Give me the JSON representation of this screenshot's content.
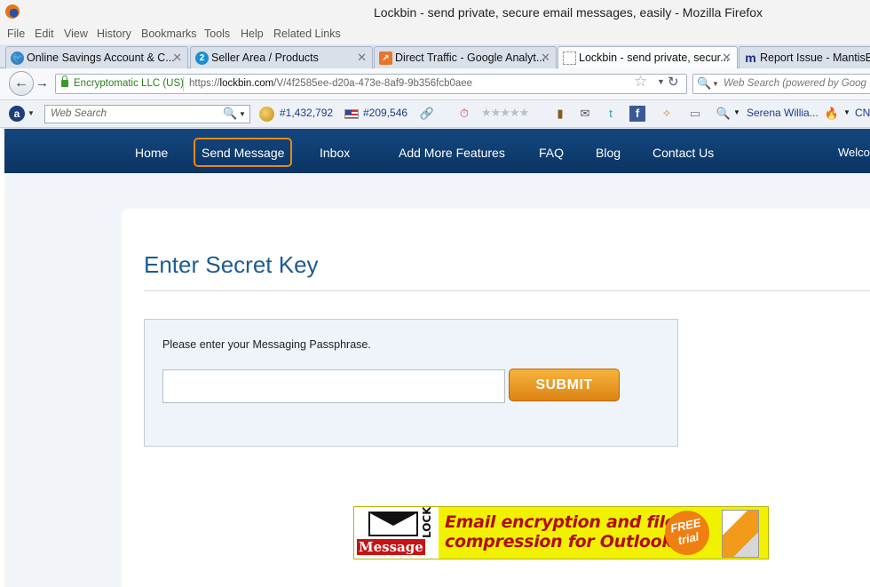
{
  "window": {
    "title": "Lockbin - send private, secure email messages, easily - Mozilla Firefox"
  },
  "menu": [
    "File",
    "Edit",
    "View",
    "History",
    "Bookmarks",
    "Tools",
    "Help",
    "Related Links"
  ],
  "tabs": [
    {
      "label": "Online Savings Account & C...",
      "icon": "blue-bird-icon"
    },
    {
      "label": "Seller Area / Products",
      "icon": "number-2-icon"
    },
    {
      "label": "Direct Traffic - Google Analyt...",
      "icon": "analytics-icon"
    },
    {
      "label": "Lockbin - send private, secur...",
      "icon": "blank-page-icon",
      "active": true
    },
    {
      "label": "Report Issue - MantisBT",
      "icon": "mantis-icon"
    }
  ],
  "navbar": {
    "identity": "Encryptomatic LLC (US)",
    "url_prefix": "https://",
    "url_host": "lockbin.com",
    "url_path": "/V/4f2585ee-d20a-473e-8af9-9b356fcb0aee",
    "search_placeholder": "Web Search (powered by Goog"
  },
  "toolbar": {
    "search_placeholder": "Web Search",
    "alexa_rank": "#1,432,792",
    "us_rank": "#209,546",
    "user_name": "Serena Willia...",
    "trailing": "CN"
  },
  "site_nav": {
    "items": [
      "Home",
      "Send Message",
      "Inbox",
      "Add More Features",
      "FAQ",
      "Blog",
      "Contact Us"
    ],
    "welcome": "Welcome",
    "highlighted": "Send Message",
    "highlight_color": "#e48a1b"
  },
  "main": {
    "title": "Enter Secret Key",
    "prompt": "Please enter your Messaging Passphrase.",
    "passphrase_value": "",
    "submit_label": "SUBMIT"
  },
  "banner": {
    "logo_message": "Message",
    "logo_lock": "LOCK",
    "line1": "Email encryption and file",
    "line2": "compression for Outlook",
    "badge_line1": "FREE",
    "badge_line2": "trial"
  },
  "colors": {
    "nav_bg": "#0d3e74",
    "title_blue": "#1d5b94",
    "submit_orange": "#e8951f"
  }
}
